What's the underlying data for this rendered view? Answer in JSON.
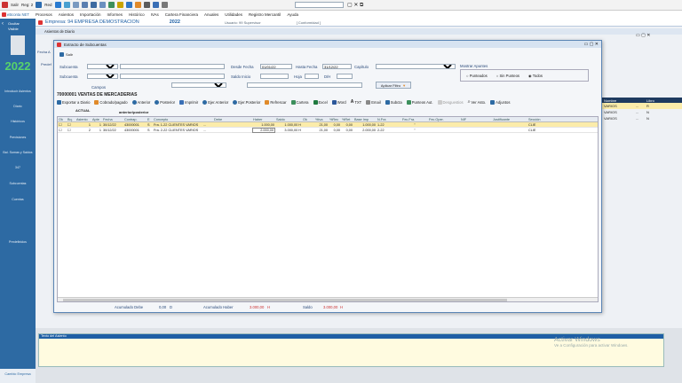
{
  "toolbar": {
    "items": [
      "Salir",
      "Reg: 2",
      "Red"
    ]
  },
  "menu": {
    "items": [
      "Procesos",
      "Asientos",
      "Importación",
      "Informes",
      "Histórico",
      "IVAs",
      "Cartera Financiera",
      "Anuales",
      "Utilidades",
      "Registro Mercantil",
      "Ayuda"
    ]
  },
  "app": {
    "brand": "eBconta NET"
  },
  "sidebar": {
    "toggle": [
      "Ocultar",
      "Visible"
    ],
    "year": "2022",
    "items": [
      "Introducir Asientos",
      "Diario",
      "Históricos",
      "Previsiones",
      "Bal. Sumas y Saldos",
      "347",
      "Subcuentas",
      "Cuentas",
      "Predefinidos"
    ],
    "footer": "Cambio Empresa"
  },
  "company": {
    "label": "Empresa: 94  EMPRESA DEMOSTRACION",
    "year": "2022",
    "user": "Usuario: 99  Supervisor",
    "status": "[ Conformidad ]"
  },
  "bgwin": {
    "title": "Asientos de Diario",
    "fecha_label": "Fecha A",
    "pred_label": "Predef"
  },
  "dialog": {
    "title": "Extracto de Subcuentas",
    "salir": "Salir",
    "labels": {
      "subcuenta": "Subcuenta",
      "subcuenta2": "Subcuenta",
      "desde": "Desde Fecha",
      "hasta": "Hasta Fecha",
      "capitulo": "Capítulo",
      "saldo_inicio": "Saldo Inicio",
      "hoja": "Hoja",
      "dh": "D/H",
      "campos": "Campos",
      "mostrar": "Mostrar Apuntes",
      "aplicar": "Aplicar Filtro"
    },
    "values": {
      "desde": "01/01/22",
      "hasta": "31/12/22"
    },
    "radios": [
      "Punteados",
      "Sin Punteos",
      "Todos"
    ],
    "account": "70000001  VENTAS DE MERCADERIAS",
    "actual": "ACTUAL",
    "anterior": "anterior/posterior",
    "actions": [
      "Exportar a Diario",
      "Cobrado/pagado",
      "Anterior",
      "Posterior",
      "Imprimir",
      "Ejer.Anterior",
      "Ejer.Posterior",
      "Refrescar",
      "Cartera",
      "Excel",
      "Word",
      "TXT",
      "Email",
      "Subcta",
      "Punteos Aut.",
      "Desguestios",
      "Ver Asto.",
      "Adjuntos"
    ],
    "columns": [
      "Ok",
      "Bq.",
      "Asiento",
      "Apte",
      "Fecha",
      "Contrap.",
      "E",
      "Concepto",
      "Debe",
      "Haber",
      "Saldo",
      "Ok",
      "%Iva",
      "%Rec",
      "%Ret",
      "Base Imp",
      "N.Fra",
      "Fec.Fra.",
      "Fec.Oper.",
      "NIF",
      "Justificante",
      "Sección"
    ],
    "rows": [
      {
        "asiento": "1",
        "apte": "1",
        "fecha": "30/12/22",
        "contrap": "43000001",
        "e": "S",
        "concepto": "Fra. 1-22 CLIENTES VARIOS",
        "dots": "...",
        "debe": "",
        "haber": "1.000,00",
        "saldo": "1.000,00 H",
        "iva": "21,00",
        "rec": "0,00",
        "ret": "0,00",
        "base": "1.000,00",
        "nfra": "1-22",
        "fec": "''",
        "sec": "CLIE"
      },
      {
        "asiento": "2",
        "apte": "1",
        "fecha": "30/12/22",
        "contrap": "43000001",
        "e": "S",
        "concepto": "Fra. 2-22 CLIENTES VARIOS",
        "dots": "...",
        "debe": "",
        "haber": "2.000,00",
        "saldo": "3.000,00 H",
        "iva": "21,00",
        "rec": "0,00",
        "ret": "0,00",
        "base": "2.000,00",
        "nfra": "2-22",
        "fec": "''",
        "sec": "CLIE"
      }
    ],
    "totals": {
      "debe_label": "Acumulado Debe",
      "debe_val": "0,00",
      "debe_dh": "D",
      "haber_label": "Acumulado Haber",
      "haber_val": "3.000,00",
      "haber_dh": "H",
      "saldo_label": "Saldo",
      "saldo_val": "3.000,00",
      "saldo_dh": "H"
    }
  },
  "right_table": {
    "headers": [
      "Nombre",
      "Libro"
    ],
    "rows": [
      [
        "VARIOS",
        "...",
        "R"
      ],
      [
        "VARIOS",
        "...",
        "N"
      ],
      [
        "VARIOS",
        "...",
        "N"
      ]
    ]
  },
  "notes": {
    "label": "Texto del Asiento"
  },
  "watermark": {
    "line1": "Activar Windows",
    "line2": "Ve a Configuración para activar Windows."
  }
}
